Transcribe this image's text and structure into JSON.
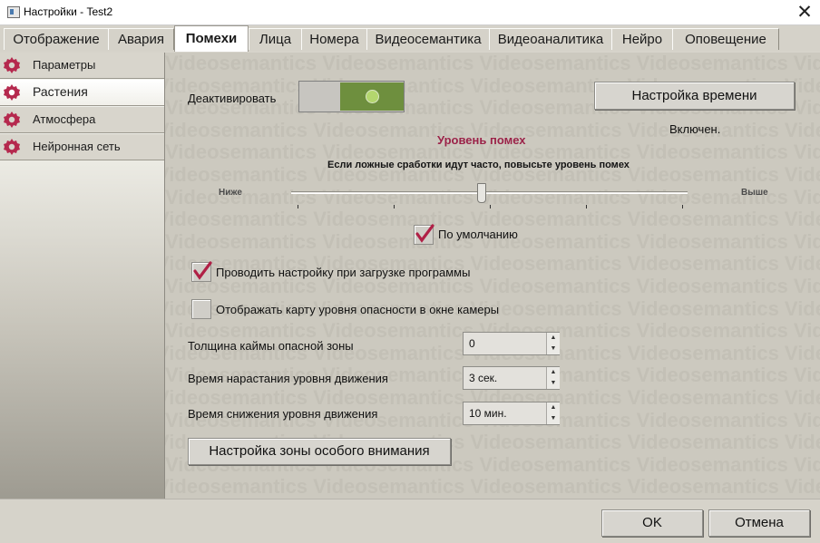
{
  "window": {
    "title": "Настройки - Test2",
    "close_glyph": "✕"
  },
  "tabs": [
    {
      "label": "Отображение"
    },
    {
      "label": "Авария"
    },
    {
      "label": "Помехи"
    },
    {
      "label": "Лица"
    },
    {
      "label": "Номера"
    },
    {
      "label": "Видеосемантика"
    },
    {
      "label": "Видеоаналитика"
    },
    {
      "label": "Нейро"
    },
    {
      "label": "Оповещение"
    }
  ],
  "sidebar": {
    "items": [
      {
        "label": "Параметры",
        "icon": "gear-icon"
      },
      {
        "label": "Растения",
        "icon": "gear-icon",
        "active": true
      },
      {
        "label": "Атмосфера",
        "icon": "gear-icon"
      },
      {
        "label": "Нейронная сеть",
        "icon": "gear-icon"
      }
    ]
  },
  "watermark": "Videosemantics",
  "panel": {
    "deactivate_label": "Деактивировать",
    "toggle_state": "on",
    "time_setup_button": "Настройка времени",
    "status_text": "Включен.",
    "noise_title": "Уровень помех",
    "noise_hint": "Если ложные сработки идут часто, повысьте уровень помех",
    "slider_min_label": "Ниже",
    "slider_max_label": "Выше",
    "slider_position": 0.47,
    "slider_tick_count": 5,
    "default_checkbox": {
      "label": "По умолчанию",
      "checked": true
    },
    "configure_on_load": {
      "label": "Проводить настройку при загрузке программы",
      "checked": true
    },
    "show_danger_map": {
      "label": "Отображать карту уровня опасности в окне камеры",
      "checked": false
    },
    "border_thickness": {
      "label": "Толщина каймы опасной зоны",
      "value": "0"
    },
    "rise_time": {
      "label": "Время нарастания уровня движения",
      "value": "3 сек."
    },
    "fall_time": {
      "label": "Время снижения уровня движения",
      "value": "10 мин."
    },
    "special_zone_button": "Настройка зоны особого внимания"
  },
  "footer": {
    "ok": "OK",
    "cancel": "Отмена"
  },
  "colors": {
    "accent": "#9b2349",
    "toggle_on": "#6e8f3e",
    "content_bg": "#ccc9bf"
  }
}
